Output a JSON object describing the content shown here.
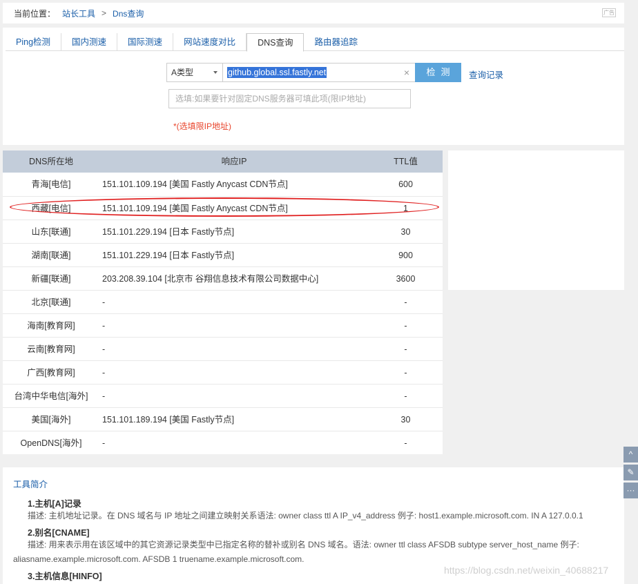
{
  "breadcrumb": {
    "label": "当前位置：",
    "parent": "站长工具",
    "separator": ">",
    "current": "Dns查询",
    "ad": "广告"
  },
  "tabs": [
    "Ping检测",
    "国内测速",
    "国际测速",
    "网站速度对比",
    "DNS查询",
    "路由器追踪"
  ],
  "active_tab": "DNS查询",
  "form": {
    "type_select": "A类型",
    "domain_value": "github.global.ssl.fastly.net",
    "clear_icon": "×",
    "detect_button": "检测",
    "history_link": "查询记录",
    "dns_placeholder": "选填:如果要针对固定DNS服务器可填此项(限IP地址)",
    "hint": "*(选填限IP地址)"
  },
  "table": {
    "headers": [
      "DNS所在地",
      "响应IP",
      "TTL值"
    ],
    "rows": [
      [
        "青海[电信]",
        "151.101.109.194 [美国 Fastly Anycast CDN节点]",
        "600"
      ],
      [
        "西藏[电信]",
        "151.101.109.194 [美国 Fastly Anycast CDN节点]",
        "1"
      ],
      [
        "山东[联通]",
        "151.101.229.194 [日本 Fastly节点]",
        "30"
      ],
      [
        "湖南[联通]",
        "151.101.229.194 [日本 Fastly节点]",
        "900"
      ],
      [
        "新疆[联通]",
        "203.208.39.104 [北京市 谷翔信息技术有限公司数据中心]",
        "3600"
      ],
      [
        "北京[联通]",
        "-",
        "-"
      ],
      [
        "海南[教育网]",
        "-",
        "-"
      ],
      [
        "云南[教育网]",
        "-",
        "-"
      ],
      [
        "广西[教育网]",
        "-",
        "-"
      ],
      [
        "台湾中华电信[海外]",
        "-",
        "-"
      ],
      [
        "美国[海外]",
        "151.101.189.194 [美国 Fastly节点]",
        "30"
      ],
      [
        "OpenDNS[海外]",
        "-",
        "-"
      ]
    ]
  },
  "intro": {
    "title": "工具简介",
    "h1": "1.主机[A]记录",
    "d1": "描述: 主机地址记录。在 DNS 域名与 IP 地址之间建立映射关系语法: owner class ttl A IP_v4_address 例子: host1.example.microsoft.com. IN A 127.0.0.1",
    "h2": "2.别名[CNAME]",
    "d2a": "描述: 用来表示用在该区域中的其它资源记录类型中已指定名称的替补或别名 DNS 域名。语法: owner ttl class AFSDB subtype server_host_name 例子:",
    "d2b": "aliasname.example.microsoft.com. AFSDB 1 truename.example.microsoft.com.",
    "h3": "3.主机信息[HINFO]"
  },
  "float_buttons": {
    "top": "^",
    "feedback": "✎",
    "more": "···"
  },
  "watermark": "https://blog.csdn.net/weixin_40688217"
}
